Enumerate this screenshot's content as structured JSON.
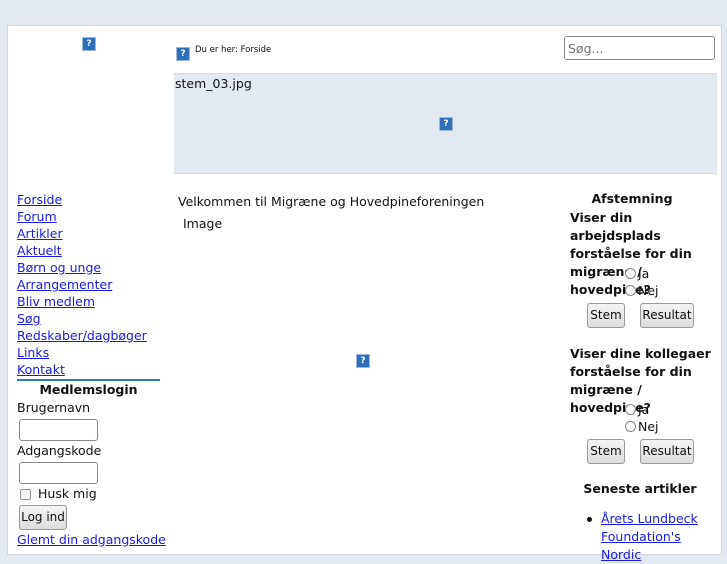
{
  "breadcrumb": {
    "label": "Du er her: Forside"
  },
  "search": {
    "placeholder": "Søg..."
  },
  "banner": {
    "alt": "stem_03.jpg"
  },
  "nav": [
    "Forside",
    "Forum",
    "Artikler",
    "Aktuelt",
    "Børn og unge",
    "Arrangementer",
    "Bliv medlem",
    "Søg",
    "Redskaber/dagbøger",
    "Links",
    "Kontakt"
  ],
  "login": {
    "title": "Medlemslogin",
    "username_label": "Brugernavn",
    "password_label": "Adgangskode",
    "remember_label": "Husk mig",
    "submit": "Log ind",
    "forgot": "Glemt din adgangskode"
  },
  "main": {
    "welcome": "Velkommen til Migræne og Hovedpineforeningen",
    "image_alt": "Image"
  },
  "poll": {
    "title": "Afstemning",
    "questions": [
      {
        "q": "Viser din arbejdsplads forståelse for din migræne / hovedpine?",
        "options": [
          "Ja",
          "Nej"
        ]
      },
      {
        "q": "Viser dine kollegaer forståelse for din migræne / hovedpine?",
        "options": [
          "Ja",
          "Nej"
        ]
      }
    ],
    "vote": "Stem",
    "results": "Resultat"
  },
  "latest": {
    "title": "Seneste artikler",
    "items": [
      "Årets Lundbeck Foundation's Nordic"
    ]
  }
}
